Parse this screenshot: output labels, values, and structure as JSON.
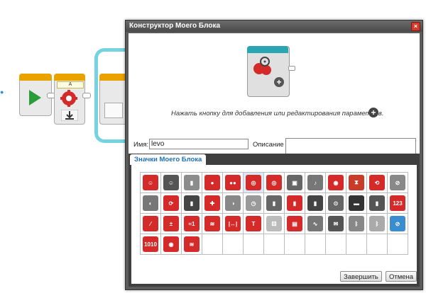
{
  "canvas": {
    "marker": "●",
    "myblock_port": "A"
  },
  "dialog": {
    "title": "Конструктор Моего Блока",
    "close_label": "×",
    "hint": "Нажать кнопку для добавления или редактирования параметров.",
    "hint_plus": "+",
    "name_label": "Имя:",
    "name_value": "levo",
    "description_label": "Описание",
    "description_value": "",
    "tab_label": "Значки Моего Блока",
    "finish_label": "Завершить",
    "cancel_label": "Отмена"
  },
  "colors": {
    "accent_blue": "#1d6fb8",
    "block_red": "#d42a2a",
    "ev3_teal": "#2aa6b3",
    "start_green": "#2a9d3a"
  },
  "icon_grid": {
    "rows": [
      [
        {
          "name": "brain-icon",
          "glyph": "☺",
          "bg": "#d42a2a"
        },
        {
          "name": "brain-gray-icon",
          "glyph": "☺",
          "bg": "#555555"
        },
        {
          "name": "brick-icon",
          "glyph": "▮",
          "bg": "#8c8c8c"
        },
        {
          "name": "large-motor-icon",
          "glyph": "●",
          "bg": "#d42a2a"
        },
        {
          "name": "motor-pair-icon",
          "glyph": "●●",
          "bg": "#d42a2a"
        },
        {
          "name": "steering-icon",
          "glyph": "◎",
          "bg": "#d42a2a",
          "selected": true
        },
        {
          "name": "tank-icon",
          "glyph": "◎",
          "bg": "#d42a2a"
        },
        {
          "name": "display-icon",
          "glyph": "▣",
          "bg": "#666666"
        },
        {
          "name": "sound-icon",
          "glyph": "♪",
          "bg": "#777777"
        },
        {
          "name": "brick-buttons-icon",
          "glyph": "◉",
          "bg": "#d42a2a"
        },
        {
          "name": "hourglass-icon",
          "glyph": "⧗",
          "bg": "#c93c2a"
        },
        {
          "name": "loop-icon",
          "glyph": "⟲",
          "bg": "#d42a2a"
        },
        {
          "name": "sensor-off-icon",
          "glyph": "⊘",
          "bg": "#888888"
        }
      ],
      [
        {
          "name": "gyro-icon",
          "glyph": "◐",
          "bg": "#777777"
        },
        {
          "name": "rotation-icon",
          "glyph": "⟳",
          "bg": "#d42a2a"
        },
        {
          "name": "touch-icon",
          "glyph": "▮",
          "bg": "#444444"
        },
        {
          "name": "medium-motor-icon",
          "glyph": "✚",
          "bg": "#d42a2a"
        },
        {
          "name": "motor-rotation-icon",
          "glyph": "◑",
          "bg": "#888888"
        },
        {
          "name": "timer-icon",
          "glyph": "◷",
          "bg": "#999999"
        },
        {
          "name": "ultrasonic-icon",
          "glyph": "▮",
          "bg": "#666666"
        },
        {
          "name": "color-sensor-icon",
          "glyph": "▮",
          "bg": "#d42a2a"
        },
        {
          "name": "infrared-icon",
          "glyph": "▮",
          "bg": "#444444"
        },
        {
          "name": "temperature-icon",
          "glyph": "⊙",
          "bg": "#666666"
        },
        {
          "name": "suitcase-icon",
          "glyph": "▬",
          "bg": "#333333"
        },
        {
          "name": "lock-icon",
          "glyph": "▮",
          "bg": "#555555"
        },
        {
          "name": "numbers-icon",
          "glyph": "123",
          "bg": "#d42a2a"
        }
      ],
      [
        {
          "name": "math-slash-icon",
          "glyph": "⁄",
          "bg": "#d42a2a"
        },
        {
          "name": "math-ops-icon",
          "glyph": "±",
          "bg": "#d42a2a"
        },
        {
          "name": "round-icon",
          "glyph": "≈1",
          "bg": "#d42a2a"
        },
        {
          "name": "random-icon",
          "glyph": "≋",
          "bg": "#d42a2a"
        },
        {
          "name": "range-icon",
          "glyph": "|↔|",
          "bg": "#d42a2a"
        },
        {
          "name": "text-icon",
          "glyph": "T",
          "bg": "#d42a2a"
        },
        {
          "name": "dice-icon",
          "glyph": "⚄",
          "bg": "#bbbbbb"
        },
        {
          "name": "file-icon",
          "glyph": "▤",
          "bg": "#d42a2a"
        },
        {
          "name": "datalog-icon",
          "glyph": "∿",
          "bg": "#777777"
        },
        {
          "name": "messaging-icon",
          "glyph": "✉",
          "bg": "#555555"
        },
        {
          "name": "bluetooth-icon",
          "glyph": "ᛒ",
          "bg": "#888888"
        },
        {
          "name": "bluetooth-off-icon",
          "glyph": "ᛒ",
          "bg": "#aaaaaa"
        },
        {
          "name": "no-wireless-icon",
          "glyph": "⊘",
          "bg": "#3a8ed0"
        }
      ],
      [
        {
          "name": "binary-icon",
          "glyph": "1010",
          "bg": "#d42a2a"
        },
        {
          "name": "stop-icon",
          "glyph": "◉",
          "bg": "#d42a2a"
        },
        {
          "name": "random-swirl-icon",
          "glyph": "≋",
          "bg": "#d42a2a"
        },
        {
          "name": "empty-cell",
          "glyph": "",
          "bg": "transparent"
        },
        {
          "name": "empty-cell",
          "glyph": "",
          "bg": "transparent"
        },
        {
          "name": "empty-cell",
          "glyph": "",
          "bg": "transparent"
        },
        {
          "name": "empty-cell",
          "glyph": "",
          "bg": "transparent"
        },
        {
          "name": "empty-cell",
          "glyph": "",
          "bg": "transparent"
        },
        {
          "name": "empty-cell",
          "glyph": "",
          "bg": "transparent"
        },
        {
          "name": "empty-cell",
          "glyph": "",
          "bg": "transparent"
        },
        {
          "name": "empty-cell",
          "glyph": "",
          "bg": "transparent"
        },
        {
          "name": "empty-cell",
          "glyph": "",
          "bg": "transparent"
        },
        {
          "name": "empty-cell",
          "glyph": "",
          "bg": "transparent"
        }
      ]
    ]
  }
}
